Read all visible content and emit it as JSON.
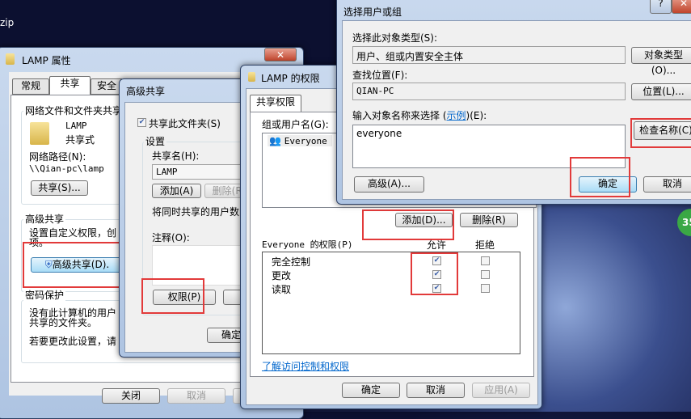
{
  "desktop": {
    "corner_text": "zip",
    "badge": "35"
  },
  "props": {
    "title": "LAMP 属性",
    "tabs": [
      "常规",
      "共享",
      "安全"
    ],
    "active_tab": "共享",
    "net_group": "网络文件和文件夹共享",
    "folder_name": "LAMP",
    "share_state": "共享式",
    "path_label": "网络路径(N):",
    "path": "\\\\Qian-pc\\lamp",
    "share_btn": "共享(S)...",
    "adv_group": "高级共享",
    "adv_text1": "设置自定义权限，创",
    "adv_text2": "项。",
    "adv_btn": "高级共享(D).",
    "pwd_group": "密码保护",
    "pwd_text1": "没有此计算机的用户",
    "pwd_text2": "共享的文件夹。",
    "pwd_text3": "若要更改此设置，请",
    "close_btn": "关闭",
    "cancel_btn": "取消"
  },
  "adv": {
    "title": "高级共享",
    "share_check": "共享此文件夹(S)",
    "share_checked": true,
    "settings": "设置",
    "name_label": "共享名(H):",
    "name_value": "LAMP",
    "add_btn": "添加(A)",
    "remove_btn": "删除(R)",
    "limit_text": "将同时共享的用户数",
    "comment_label": "注释(O):",
    "perm_btn": "权限(P)",
    "ok_btn": "确定"
  },
  "perm": {
    "title": "LAMP 的权限",
    "tab": "共享权限",
    "users_label": "组或用户名(G):",
    "users": [
      "Everyone"
    ],
    "add_btn": "添加(D)...",
    "remove_btn": "删除(R)",
    "perm_label": "Everyone 的权限(P)",
    "allow": "允许",
    "deny": "拒绝",
    "rows": [
      {
        "name": "完全控制",
        "allow": true,
        "deny": false
      },
      {
        "name": "更改",
        "allow": true,
        "deny": false
      },
      {
        "name": "读取",
        "allow": true,
        "deny": false
      }
    ],
    "link": "了解访问控制和权限",
    "ok_btn": "确定",
    "cancel_btn": "取消",
    "apply_btn": "应用(A)"
  },
  "select": {
    "title": "选择用户或组",
    "type_label": "选择此对象类型(S):",
    "type_value": "用户、组或内置安全主体",
    "type_btn": "对象类型(O)...",
    "loc_label": "查找位置(F):",
    "loc_value": "QIAN-PC",
    "loc_btn": "位置(L)...",
    "name_label_pre": "输入对象名称来选择 (",
    "name_label_link": "示例",
    "name_label_post": ")(E):",
    "name_value": "everyone",
    "check_btn": "检查名称(C)",
    "adv_btn": "高级(A)...",
    "ok_btn": "确定",
    "cancel_btn": "取消"
  },
  "colors": {
    "highlight": "#e23a3a",
    "link": "#0066cc"
  }
}
